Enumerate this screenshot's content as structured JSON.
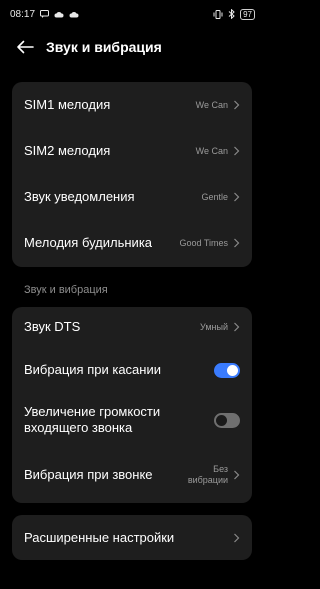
{
  "status_bar": {
    "time": "08:17",
    "left_icons": [
      "message-icon",
      "cloud-icon",
      "cloud-icon"
    ],
    "right_icons": [
      "vibrate-icon",
      "bluetooth-icon"
    ],
    "battery": "97"
  },
  "header": {
    "title": "Звук и вибрация"
  },
  "ringtones": [
    {
      "label": "SIM1 мелодия",
      "value": "We Can"
    },
    {
      "label": "SIM2 мелодия",
      "value": "We Can"
    },
    {
      "label": "Звук уведомления",
      "value": "Gentle"
    },
    {
      "label": "Мелодия будильника",
      "value": "Good Times"
    }
  ],
  "section": {
    "title": "Звук и вибрация"
  },
  "sound": {
    "dts": {
      "label": "Звук DTS",
      "value": "Умный"
    },
    "touch_vibration": {
      "label": "Вибрация при касании",
      "on": true
    },
    "volume_increase": {
      "label_line1": "Увеличение громкости",
      "label_line2": "входящего звонка",
      "on": false
    },
    "ring_vibration": {
      "label": "Вибрация при звонке",
      "value_line1": "Без",
      "value_line2": "вибрации"
    }
  },
  "advanced": {
    "label": "Расширенные настройки"
  },
  "colors": {
    "accent": "#3a7bfd",
    "card": "#1e1e1e",
    "background": "#000000"
  }
}
